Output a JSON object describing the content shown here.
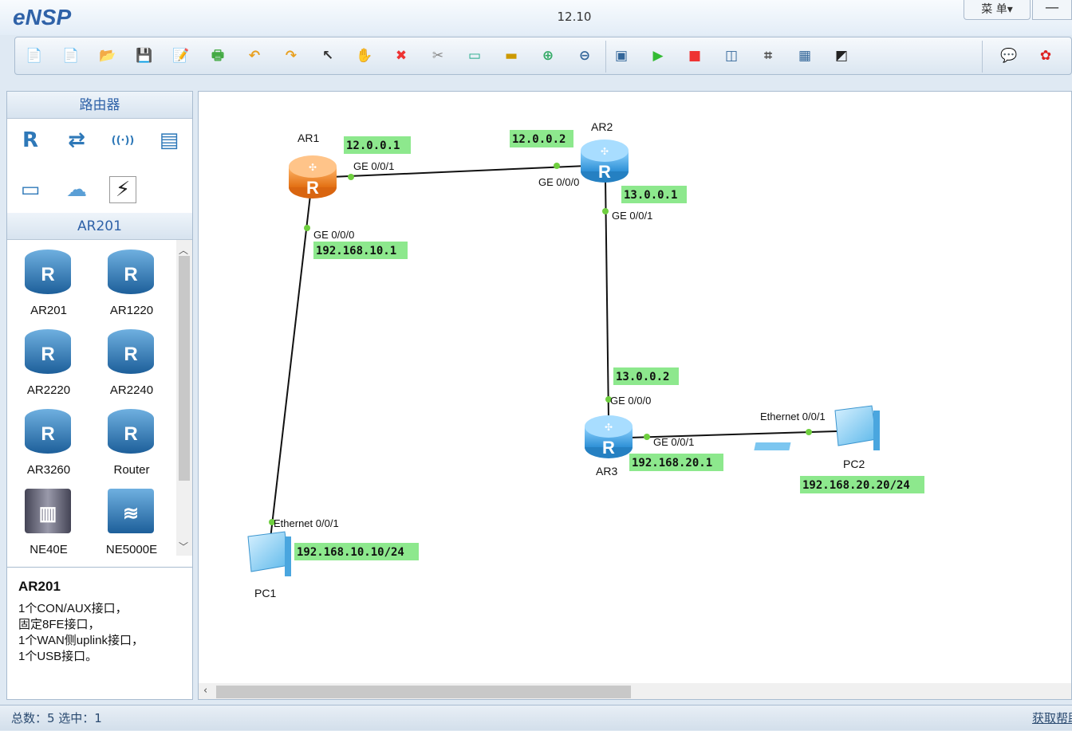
{
  "app": {
    "logo": "eNSP",
    "title": "12.10",
    "menu_label": "菜 单▾",
    "minimize_label": "—"
  },
  "toolbar": {
    "icons": [
      "new-topology-icon",
      "new-example-icon",
      "open-icon",
      "save-icon",
      "save-as-icon",
      "print-icon",
      "undo-icon",
      "redo-icon",
      "select-icon",
      "pan-icon",
      "delete-icon",
      "delete-link-icon",
      "text-icon",
      "rectangle-icon",
      "zoom-in-icon",
      "zoom-out-icon",
      "interface-label-icon",
      "start-icon",
      "stop-icon",
      "capture-icon",
      "topology-icon",
      "grid-icon",
      "screenshot-icon",
      "chat-icon",
      "huawei-icon"
    ]
  },
  "left": {
    "category_title": "路由器",
    "model_title": "AR201",
    "categories": [
      "router-category-icon",
      "switch-category-icon",
      "wlan-category-icon",
      "firewall-category-icon",
      "pc-category-icon",
      "cloud-category-icon",
      "link-category-icon"
    ],
    "devices": [
      {
        "label": "AR201"
      },
      {
        "label": "AR1220"
      },
      {
        "label": "AR2220"
      },
      {
        "label": "AR2240"
      },
      {
        "label": "AR3260"
      },
      {
        "label": "Router"
      },
      {
        "label": "NE40E"
      },
      {
        "label": "NE5000E"
      }
    ],
    "desc_title": "AR201",
    "desc_lines": [
      "1个CON/AUX接口，",
      "固定8FE接口，",
      "1个WAN侧uplink接口，",
      "1个USB接口。"
    ]
  },
  "topology": {
    "devices": [
      {
        "name": "AR1",
        "type": "router",
        "color": "#f08a2c"
      },
      {
        "name": "AR2",
        "type": "router",
        "color": "#3aa0e0"
      },
      {
        "name": "AR3",
        "type": "router",
        "color": "#3aa0e0"
      },
      {
        "name": "PC1",
        "type": "pc"
      },
      {
        "name": "PC2",
        "type": "pc"
      }
    ],
    "ip_labels": [
      "12.0.0.1",
      "12.0.0.2",
      "13.0.0.1",
      "192.168.10.1",
      "13.0.0.2",
      "192.168.20.1",
      "192.168.20.20/24",
      "192.168.10.10/24"
    ],
    "interface_labels": [
      "GE 0/0/1",
      "GE 0/0/0",
      "GE 0/0/1",
      "GE 0/0/0",
      "GE 0/0/0",
      "GE 0/0/1",
      "Ethernet 0/0/1",
      "Ethernet 0/0/1"
    ],
    "ip_label_color": "#8de88d",
    "port_color": "#6fcf3f"
  },
  "status": {
    "text": "总数：5  选中：1",
    "help": "获取帮助"
  }
}
